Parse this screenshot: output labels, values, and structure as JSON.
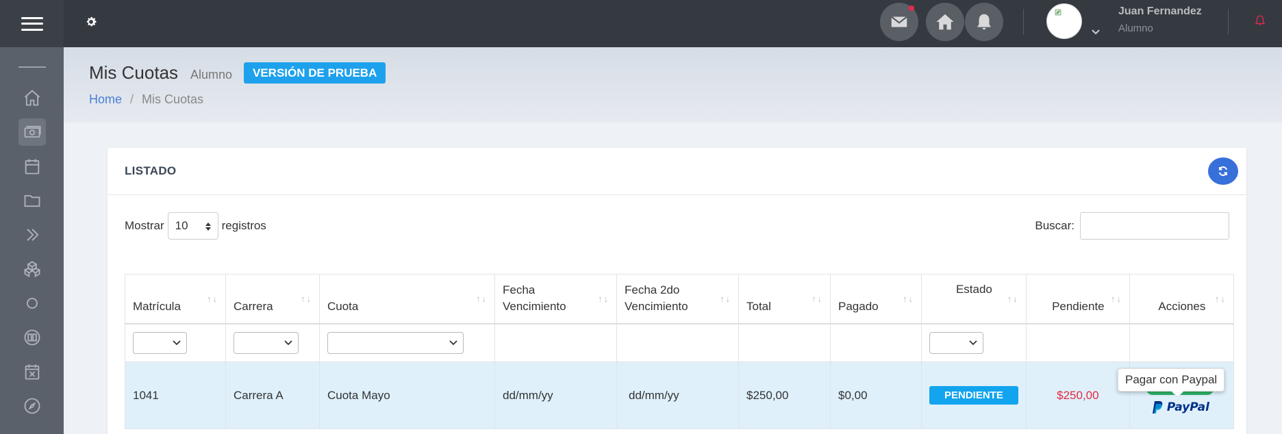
{
  "topbar": {
    "user_name": "Juan Fernandez",
    "user_role": "Alumno",
    "icons": [
      "gear-icon",
      "mail-icon",
      "home-icon",
      "bell-icon",
      "chevron-down-icon",
      "bell-small-icon"
    ]
  },
  "sidebar": {
    "items": [
      "home-icon",
      "money-icon",
      "calendar-icon",
      "folder-icon",
      "double-chevron-icon",
      "cubes-icon",
      "circle-icon",
      "book-icon",
      "calendar-x-icon",
      "compass-icon"
    ]
  },
  "header": {
    "title": "Mis Cuotas",
    "subtitle": "Alumno",
    "badge": "VERSIÓN DE PRUEBA",
    "breadcrumb": {
      "home": "Home",
      "separator": "/",
      "current": "Mis Cuotas"
    }
  },
  "card": {
    "title": "LISTADO",
    "show_label": "Mostrar",
    "page_length": "10",
    "records_label": "registros",
    "search_label": "Buscar:",
    "search_value": ""
  },
  "table": {
    "columns": [
      {
        "line1": "",
        "line2": "Matrícula"
      },
      {
        "line1": "",
        "line2": "Carrera"
      },
      {
        "line1": "",
        "line2": "Cuota"
      },
      {
        "line1": "Fecha",
        "line2": "Vencimiento"
      },
      {
        "line1": "Fecha 2do",
        "line2": "Vencimiento"
      },
      {
        "line1": "",
        "line2": "Total"
      },
      {
        "line1": "",
        "line2": "Pagado"
      },
      {
        "line1": "Estado",
        "line2": ""
      },
      {
        "line1": "",
        "line2": "Pendiente"
      },
      {
        "line1": "",
        "line2": "Acciones"
      }
    ],
    "rows": [
      {
        "matricula": "1041",
        "carrera": "Carrera A",
        "cuota": "Cuota Mayo",
        "fecha_venc": "dd/mm/yy",
        "fecha_2do": "dd/mm/yy",
        "total": "$250,00",
        "pagado": "$0,00",
        "estado": "PENDIENTE",
        "pendiente": "$250,00",
        "accion": "PayPal"
      }
    ]
  },
  "tooltip": {
    "text": "Pagar con Paypal"
  },
  "colors": {
    "accent": "#1da1ec",
    "refresh": "#3870da",
    "pending_text": "#e4283f",
    "paypal_dark": "#003087",
    "paypal_light": "#009cde"
  }
}
